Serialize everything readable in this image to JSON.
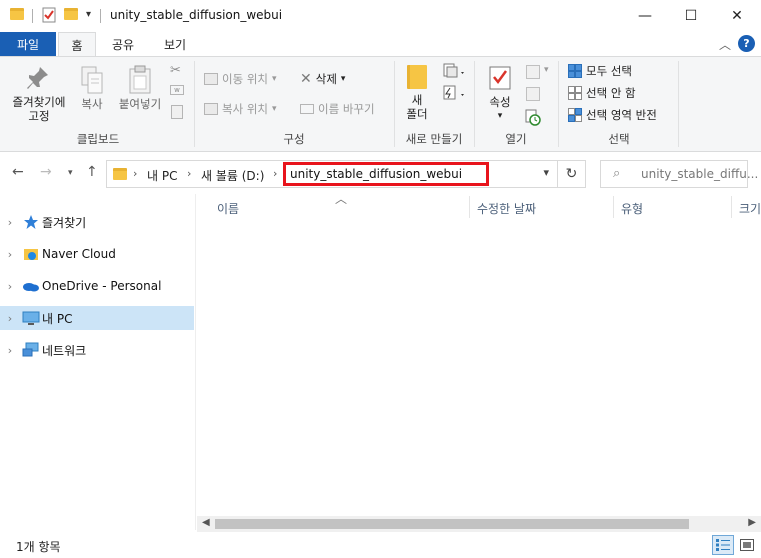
{
  "window": {
    "title": "unity_stable_diffusion_webui",
    "minimize": "—",
    "maximize": "☐",
    "close": "✕"
  },
  "ribbon_tabs": {
    "file": "파일",
    "home": "홈",
    "share": "공유",
    "view": "보기",
    "help": "?"
  },
  "ribbon": {
    "clipboard": {
      "pin_label_1": "즐겨찾기에",
      "pin_label_2": "고정",
      "copy": "복사",
      "paste": "붙여넣기",
      "group": "클립보드"
    },
    "organize": {
      "move_to": "이동 위치",
      "copy_to": "복사 위치",
      "delete": "삭제",
      "rename": "이름 바꾸기",
      "group": "구성"
    },
    "new": {
      "new_folder_1": "새",
      "new_folder_2": "폴더",
      "group": "새로 만들기"
    },
    "open": {
      "properties": "속성",
      "group": "열기"
    },
    "select": {
      "select_all": "모두 선택",
      "select_none": "선택 안 함",
      "invert": "선택 영역 반전",
      "group": "선택"
    }
  },
  "address": {
    "crumbs": [
      "내 PC",
      "새 볼륨 (D:)"
    ],
    "current": "unity_stable_diffusion_webui",
    "search_placeholder": "unity_stable_diffu..."
  },
  "nav_pane": {
    "items": [
      {
        "label": "즐겨찾기",
        "icon": "star-icon"
      },
      {
        "label": "Naver Cloud",
        "icon": "naver-cloud-icon"
      },
      {
        "label": "OneDrive - Personal",
        "icon": "onedrive-icon"
      },
      {
        "label": "내 PC",
        "icon": "pc-icon",
        "selected": true
      },
      {
        "label": "네트워크",
        "icon": "network-icon"
      }
    ]
  },
  "columns": {
    "name": "이름",
    "modified": "수정한 날짜",
    "type": "유형",
    "size": "크기"
  },
  "status": {
    "item_count": "1개 항목"
  },
  "colors": {
    "accent": "#1a5fb4",
    "selected_nav": "#cce4f7",
    "highlight_box": "#e8141c"
  }
}
